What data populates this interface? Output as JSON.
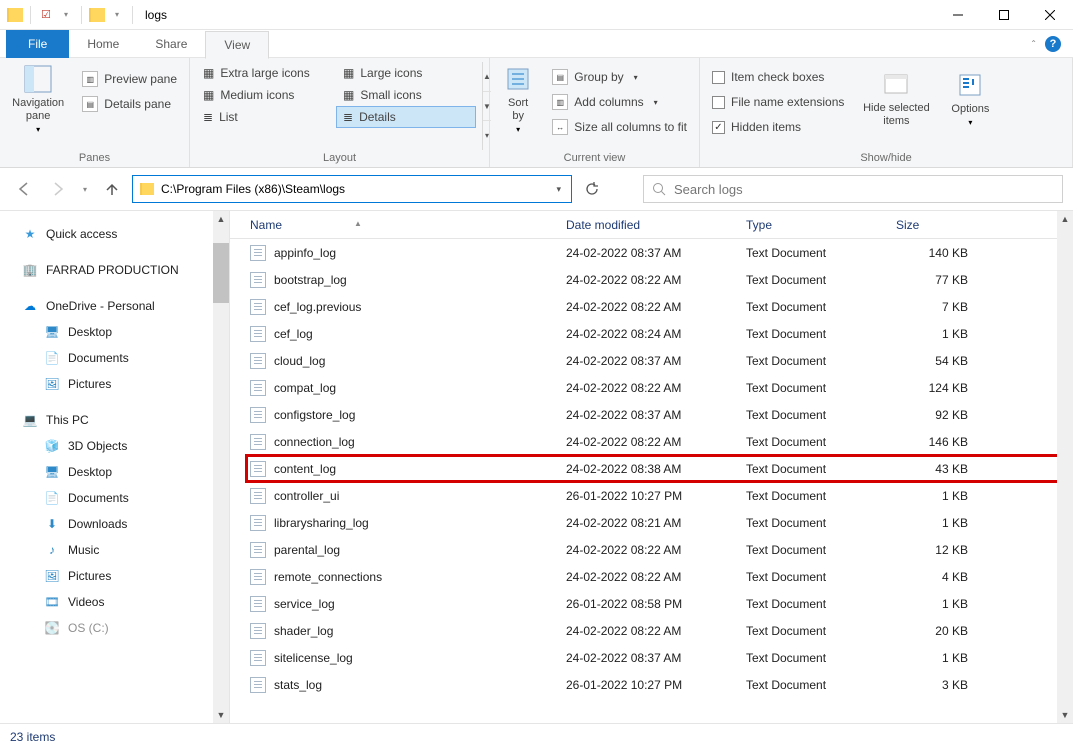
{
  "titlebar": {
    "title": "logs"
  },
  "tabs": {
    "file": "File",
    "home": "Home",
    "share": "Share",
    "view": "View"
  },
  "ribbon": {
    "panes": {
      "nav": "Navigation\npane",
      "preview": "Preview pane",
      "details": "Details pane",
      "group": "Panes"
    },
    "layout": {
      "xl": "Extra large icons",
      "lg": "Large icons",
      "md": "Medium icons",
      "sm": "Small icons",
      "list": "List",
      "details": "Details",
      "group": "Layout"
    },
    "currentview": {
      "sort": "Sort\nby",
      "groupby": "Group by",
      "addcols": "Add columns",
      "sizeall": "Size all columns to fit",
      "group": "Current view"
    },
    "showhide": {
      "checkboxes": "Item check boxes",
      "ext": "File name extensions",
      "hidden": "Hidden items",
      "hidesel": "Hide selected\nitems",
      "options": "Options",
      "group": "Show/hide"
    }
  },
  "address": {
    "path": "C:\\Program Files (x86)\\Steam\\logs",
    "search_placeholder": "Search logs"
  },
  "tree": {
    "quick": "Quick access",
    "farrad": "FARRAD PRODUCTION",
    "onedrive": "OneDrive - Personal",
    "desktop": "Desktop",
    "documents": "Documents",
    "pictures": "Pictures",
    "thispc": "This PC",
    "objects3d": "3D Objects",
    "desktop2": "Desktop",
    "documents2": "Documents",
    "downloads": "Downloads",
    "music": "Music",
    "pictures2": "Pictures",
    "videos": "Videos",
    "osc": "OS (C:)"
  },
  "columns": {
    "name": "Name",
    "date": "Date modified",
    "type": "Type",
    "size": "Size"
  },
  "files": [
    {
      "name": "appinfo_log",
      "date": "24-02-2022 08:37 AM",
      "type": "Text Document",
      "size": "140 KB"
    },
    {
      "name": "bootstrap_log",
      "date": "24-02-2022 08:22 AM",
      "type": "Text Document",
      "size": "77 KB"
    },
    {
      "name": "cef_log.previous",
      "date": "24-02-2022 08:22 AM",
      "type": "Text Document",
      "size": "7 KB"
    },
    {
      "name": "cef_log",
      "date": "24-02-2022 08:24 AM",
      "type": "Text Document",
      "size": "1 KB"
    },
    {
      "name": "cloud_log",
      "date": "24-02-2022 08:37 AM",
      "type": "Text Document",
      "size": "54 KB"
    },
    {
      "name": "compat_log",
      "date": "24-02-2022 08:22 AM",
      "type": "Text Document",
      "size": "124 KB"
    },
    {
      "name": "configstore_log",
      "date": "24-02-2022 08:37 AM",
      "type": "Text Document",
      "size": "92 KB"
    },
    {
      "name": "connection_log",
      "date": "24-02-2022 08:22 AM",
      "type": "Text Document",
      "size": "146 KB"
    },
    {
      "name": "content_log",
      "date": "24-02-2022 08:38 AM",
      "type": "Text Document",
      "size": "43 KB",
      "highlighted": true
    },
    {
      "name": "controller_ui",
      "date": "26-01-2022 10:27 PM",
      "type": "Text Document",
      "size": "1 KB"
    },
    {
      "name": "librarysharing_log",
      "date": "24-02-2022 08:21 AM",
      "type": "Text Document",
      "size": "1 KB"
    },
    {
      "name": "parental_log",
      "date": "24-02-2022 08:22 AM",
      "type": "Text Document",
      "size": "12 KB"
    },
    {
      "name": "remote_connections",
      "date": "24-02-2022 08:22 AM",
      "type": "Text Document",
      "size": "4 KB"
    },
    {
      "name": "service_log",
      "date": "26-01-2022 08:58 PM",
      "type": "Text Document",
      "size": "1 KB"
    },
    {
      "name": "shader_log",
      "date": "24-02-2022 08:22 AM",
      "type": "Text Document",
      "size": "20 KB"
    },
    {
      "name": "sitelicense_log",
      "date": "24-02-2022 08:37 AM",
      "type": "Text Document",
      "size": "1 KB"
    },
    {
      "name": "stats_log",
      "date": "26-01-2022 10:27 PM",
      "type": "Text Document",
      "size": "3 KB"
    }
  ],
  "status": {
    "count": "23 items"
  },
  "colors": {
    "accent": "#1979ca",
    "highlight": "#d40000"
  }
}
